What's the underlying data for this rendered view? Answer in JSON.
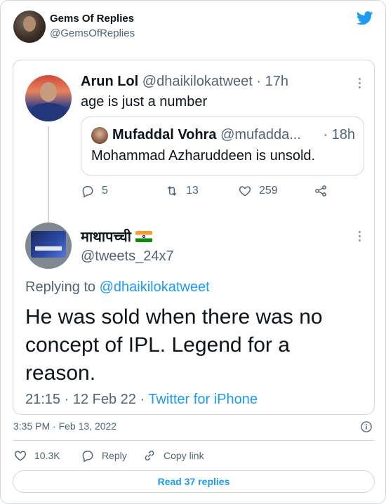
{
  "header": {
    "name": "Gems Of Replies",
    "handle": "@GemsOfReplies"
  },
  "screenshot": {
    "parent": {
      "name": "Arun Lol",
      "meta": "@dhaikilokatweet · 17h",
      "text": "age is just a number",
      "quote": {
        "name": "Mufaddal Vohra",
        "handle": "@mufadda...",
        "time": "· 18h",
        "text": "Mohammad Azharuddeen is unsold."
      },
      "actions": {
        "replies": "5",
        "retweets": "13",
        "likes": "259"
      }
    },
    "reply": {
      "name": "माथापच्ची",
      "handle": "@tweets_24x7",
      "replying_prefix": "Replying to ",
      "replying_to": "@dhaikilokatweet",
      "text": "He was sold when there was no concept of IPL. Legend for a reason.",
      "timestamp": "21:15 · 12 Feb 22 · ",
      "source": "Twitter for iPhone"
    }
  },
  "tweet_meta": {
    "time": "3:35 PM · Feb 13, 2022"
  },
  "bottom_actions": {
    "likes": "10.3K",
    "reply_label": "Reply",
    "copy_label": "Copy link"
  },
  "read_replies_label": "Read 37 replies",
  "colors": {
    "accent": "#1d9bf0",
    "secondary_text": "#536471",
    "border": "#cfd9de"
  }
}
